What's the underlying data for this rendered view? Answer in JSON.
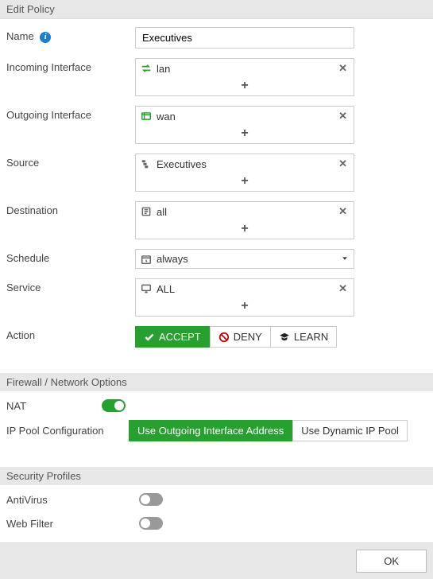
{
  "title": "Edit Policy",
  "fields": {
    "name_label": "Name",
    "name_value": "Executives"
  },
  "incoming": {
    "label": "Incoming Interface",
    "items": [
      {
        "text": "lan"
      }
    ],
    "add": "+"
  },
  "outgoing": {
    "label": "Outgoing Interface",
    "items": [
      {
        "text": "wan"
      }
    ],
    "add": "+"
  },
  "source": {
    "label": "Source",
    "items": [
      {
        "text": "Executives"
      }
    ],
    "add": "+"
  },
  "destination": {
    "label": "Destination",
    "items": [
      {
        "text": "all"
      }
    ],
    "add": "+"
  },
  "schedule": {
    "label": "Schedule",
    "value": "always"
  },
  "service": {
    "label": "Service",
    "items": [
      {
        "text": "ALL"
      }
    ],
    "add": "+"
  },
  "action": {
    "label": "Action",
    "accept": "ACCEPT",
    "deny": "DENY",
    "learn": "LEARN"
  },
  "firewall": {
    "section": "Firewall / Network Options",
    "nat_label": "NAT",
    "ippool_label": "IP Pool Configuration",
    "ippool_opt1": "Use Outgoing Interface Address",
    "ippool_opt2": "Use Dynamic IP Pool"
  },
  "security": {
    "section": "Security Profiles",
    "av_label": "AntiVirus",
    "wf_label": "Web Filter"
  },
  "footer": {
    "ok": "OK"
  },
  "glyphs": {
    "remove": "✕"
  }
}
